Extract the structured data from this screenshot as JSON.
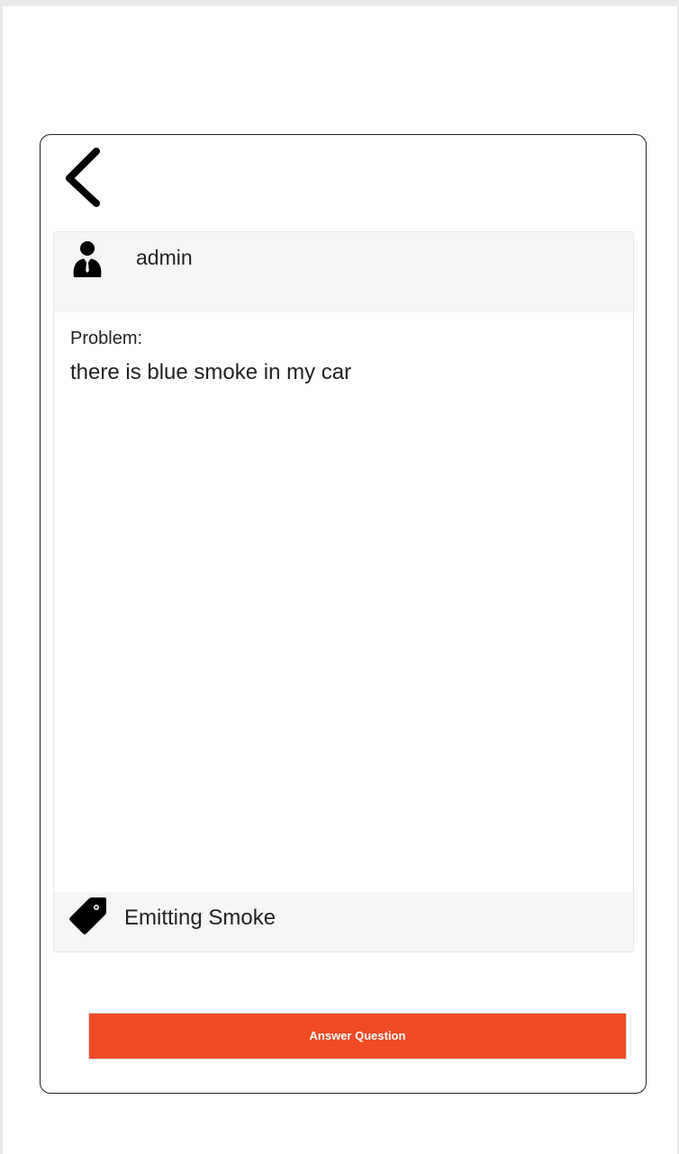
{
  "icons": {
    "back": "chevron-left-icon",
    "user": "user-icon",
    "tag": "tag-icon"
  },
  "post": {
    "author": "admin",
    "problem_label": "Problem:",
    "problem_text": "there is blue smoke in my car",
    "tag": "Emitting Smoke"
  },
  "actions": {
    "answer_label": "Answer Question"
  },
  "colors": {
    "accent": "#f04a24",
    "panel_bg": "#f6f6f6"
  }
}
